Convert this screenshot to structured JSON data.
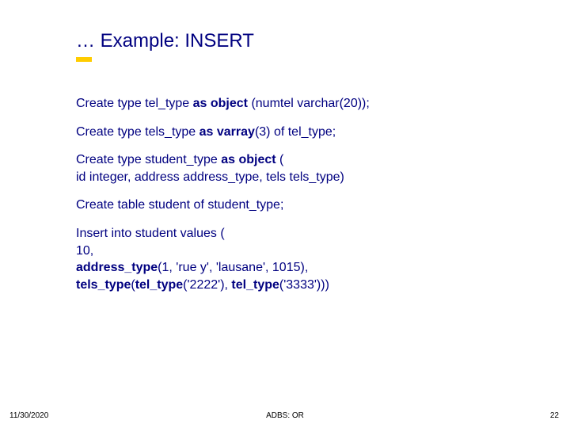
{
  "title": "… Example: INSERT",
  "statements": [
    {
      "html": "Create type tel_type <b>as object</b> (numtel varchar(20));"
    },
    {
      "html": "Create type tels_type <b>as varray</b>(3) of tel_type;"
    },
    {
      "html": "Create type student_type <b>as object</b> (<br>id integer, address address_type, tels tels_type)"
    },
    {
      "html": "Create table student of student_type;"
    },
    {
      "html": "Insert into student values (<br>10,<br><b>address_type</b>(1, 'rue y', 'lausane', 1015),<br><b>tels_type</b>(<b>tel_type</b>('2222'), <b>tel_type</b>('3333')))"
    }
  ],
  "footer": {
    "date": "11/30/2020",
    "center": "ADBS: OR",
    "page": "22"
  }
}
